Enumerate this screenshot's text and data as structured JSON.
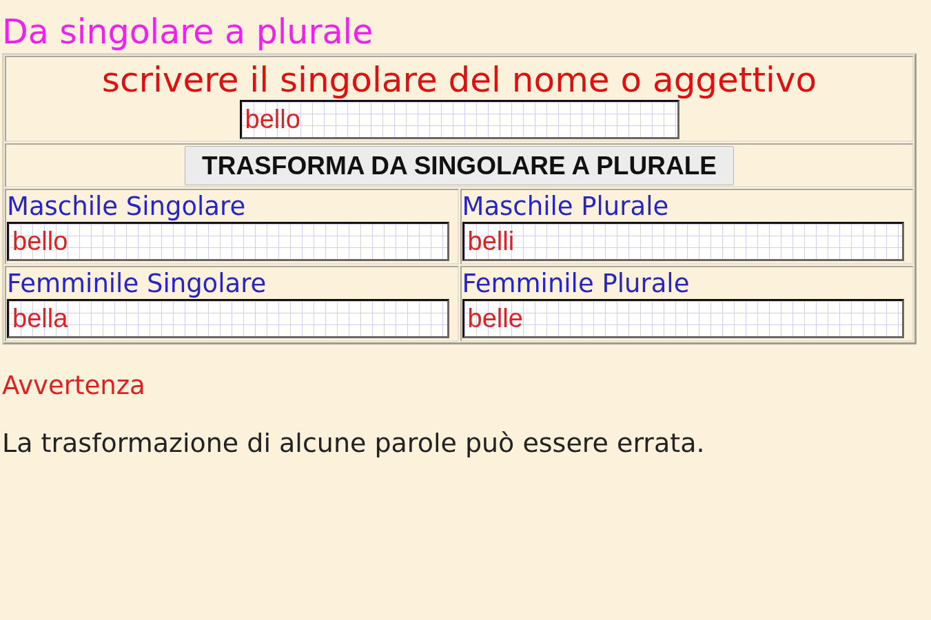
{
  "title": "Da singolare a plurale",
  "form": {
    "prompt": "scrivere il singolare del nome o aggettivo",
    "input": {
      "value": "bello"
    },
    "button": "TRASFORMA DA SINGOLARE A PLURALE",
    "results": [
      {
        "label": "Maschile Singolare",
        "value": "bello"
      },
      {
        "label": "Maschile Plurale",
        "value": "belli"
      },
      {
        "label": "Femminile Singolare",
        "value": "bella"
      },
      {
        "label": "Femminile Plurale",
        "value": "belle"
      }
    ]
  },
  "notice": {
    "heading": "Avvertenza",
    "text": "La trasformazione di alcune parole può essere errata."
  }
}
